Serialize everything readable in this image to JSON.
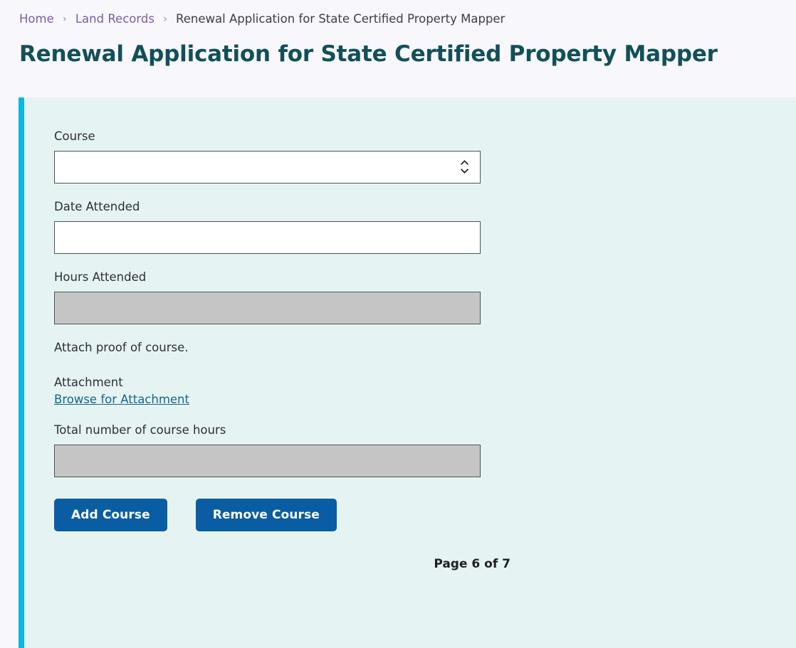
{
  "breadcrumb": {
    "items": [
      {
        "label": "Home",
        "is_link": true
      },
      {
        "label": "Land Records",
        "is_link": true
      },
      {
        "label": "Renewal Application for State Certified Property Mapper",
        "is_link": false
      }
    ],
    "separator": "›"
  },
  "header": {
    "title": "Renewal Application for State Certified Property Mapper"
  },
  "form": {
    "course": {
      "label": "Course",
      "value": "",
      "placeholder": "",
      "options": [
        ""
      ],
      "spinner_icon": "chevron-updown-icon"
    },
    "date_attended": {
      "label": "Date Attended",
      "value": "",
      "placeholder": ""
    },
    "hours_attended": {
      "label": "Hours Attended",
      "value": "",
      "disabled": true
    },
    "attach_helper_text": "Attach proof of course.",
    "attachment": {
      "label": "Attachment",
      "link_label": "Browse for Attachment"
    },
    "total_course_hours": {
      "label": "Total number of course hours",
      "value": "",
      "disabled": true
    }
  },
  "actions": {
    "add_course_label": "Add Course",
    "remove_course_label": "Remove Course"
  },
  "pager": {
    "text": "Page 6 of 7",
    "current": 6,
    "total": 7
  },
  "colors": {
    "page_background": "#f8f7fb",
    "panel_background": "#e5f4f2",
    "panel_accent": "#0cb7e2",
    "title": "#125059",
    "breadcrumb_link": "#7b5ea7",
    "button": "#0a5da3",
    "link": "#17648f",
    "disabled_field": "#c6c5c5",
    "field_border": "#4a5558"
  }
}
